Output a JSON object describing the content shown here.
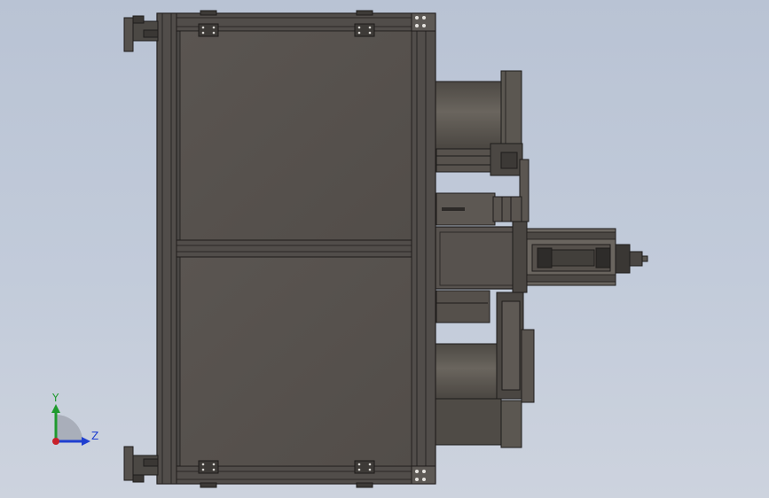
{
  "viewport": {
    "background_top": "#b9c3d4",
    "background_bottom": "#cdd3de"
  },
  "triad": {
    "y_label": "Y",
    "z_label": "Z",
    "y_color": "#1f9a2e",
    "z_color": "#1f3fd0",
    "x_color": "#c8202a"
  },
  "colors": {
    "frame": "#4a4745",
    "panel": "#58534f",
    "edge": "#1e1c1b",
    "drum": "#5f5a54"
  }
}
